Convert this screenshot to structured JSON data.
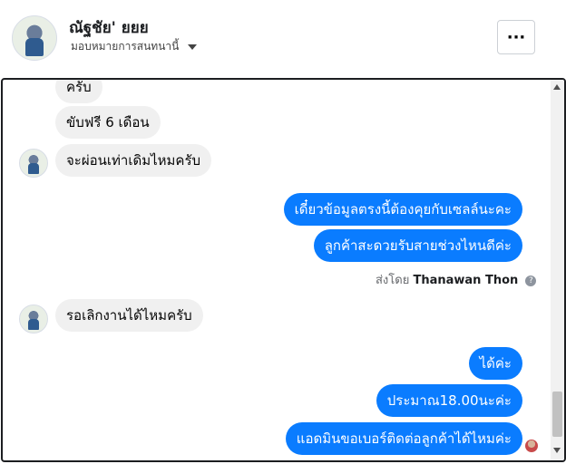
{
  "header": {
    "name": "ณัฐชัย' ยยย",
    "subtitle": "มอบหมายการสนทนานี้",
    "more_label": "···"
  },
  "messages": {
    "m1": "ครับ",
    "m2": "ขับฟรี 6 เดือน",
    "m3": "จะผ่อนเท่าเดิมไหมครับ",
    "m4": "เดี๋ยวข้อมูลตรงนี้ต้องคุยกับเซลล์นะคะ",
    "m5": "ลูกค้าสะดวยรับสายช่วงไหนดีค่ะ",
    "m6": "รอเลิกงานได้ไหมครับ",
    "m7": "ได้ค่ะ",
    "m8": "ประมาณ18.00นะค่ะ",
    "m9": "แอดมินขอเบอร์ติดต่อลูกค้าได้ไหมค่ะ"
  },
  "sent_by": {
    "prefix": "ส่งโดย",
    "agent": "Thanawan Thon",
    "help": "?"
  },
  "colors": {
    "outgoing_bubble": "#0a7cff",
    "incoming_bubble": "#f0f0f0"
  }
}
